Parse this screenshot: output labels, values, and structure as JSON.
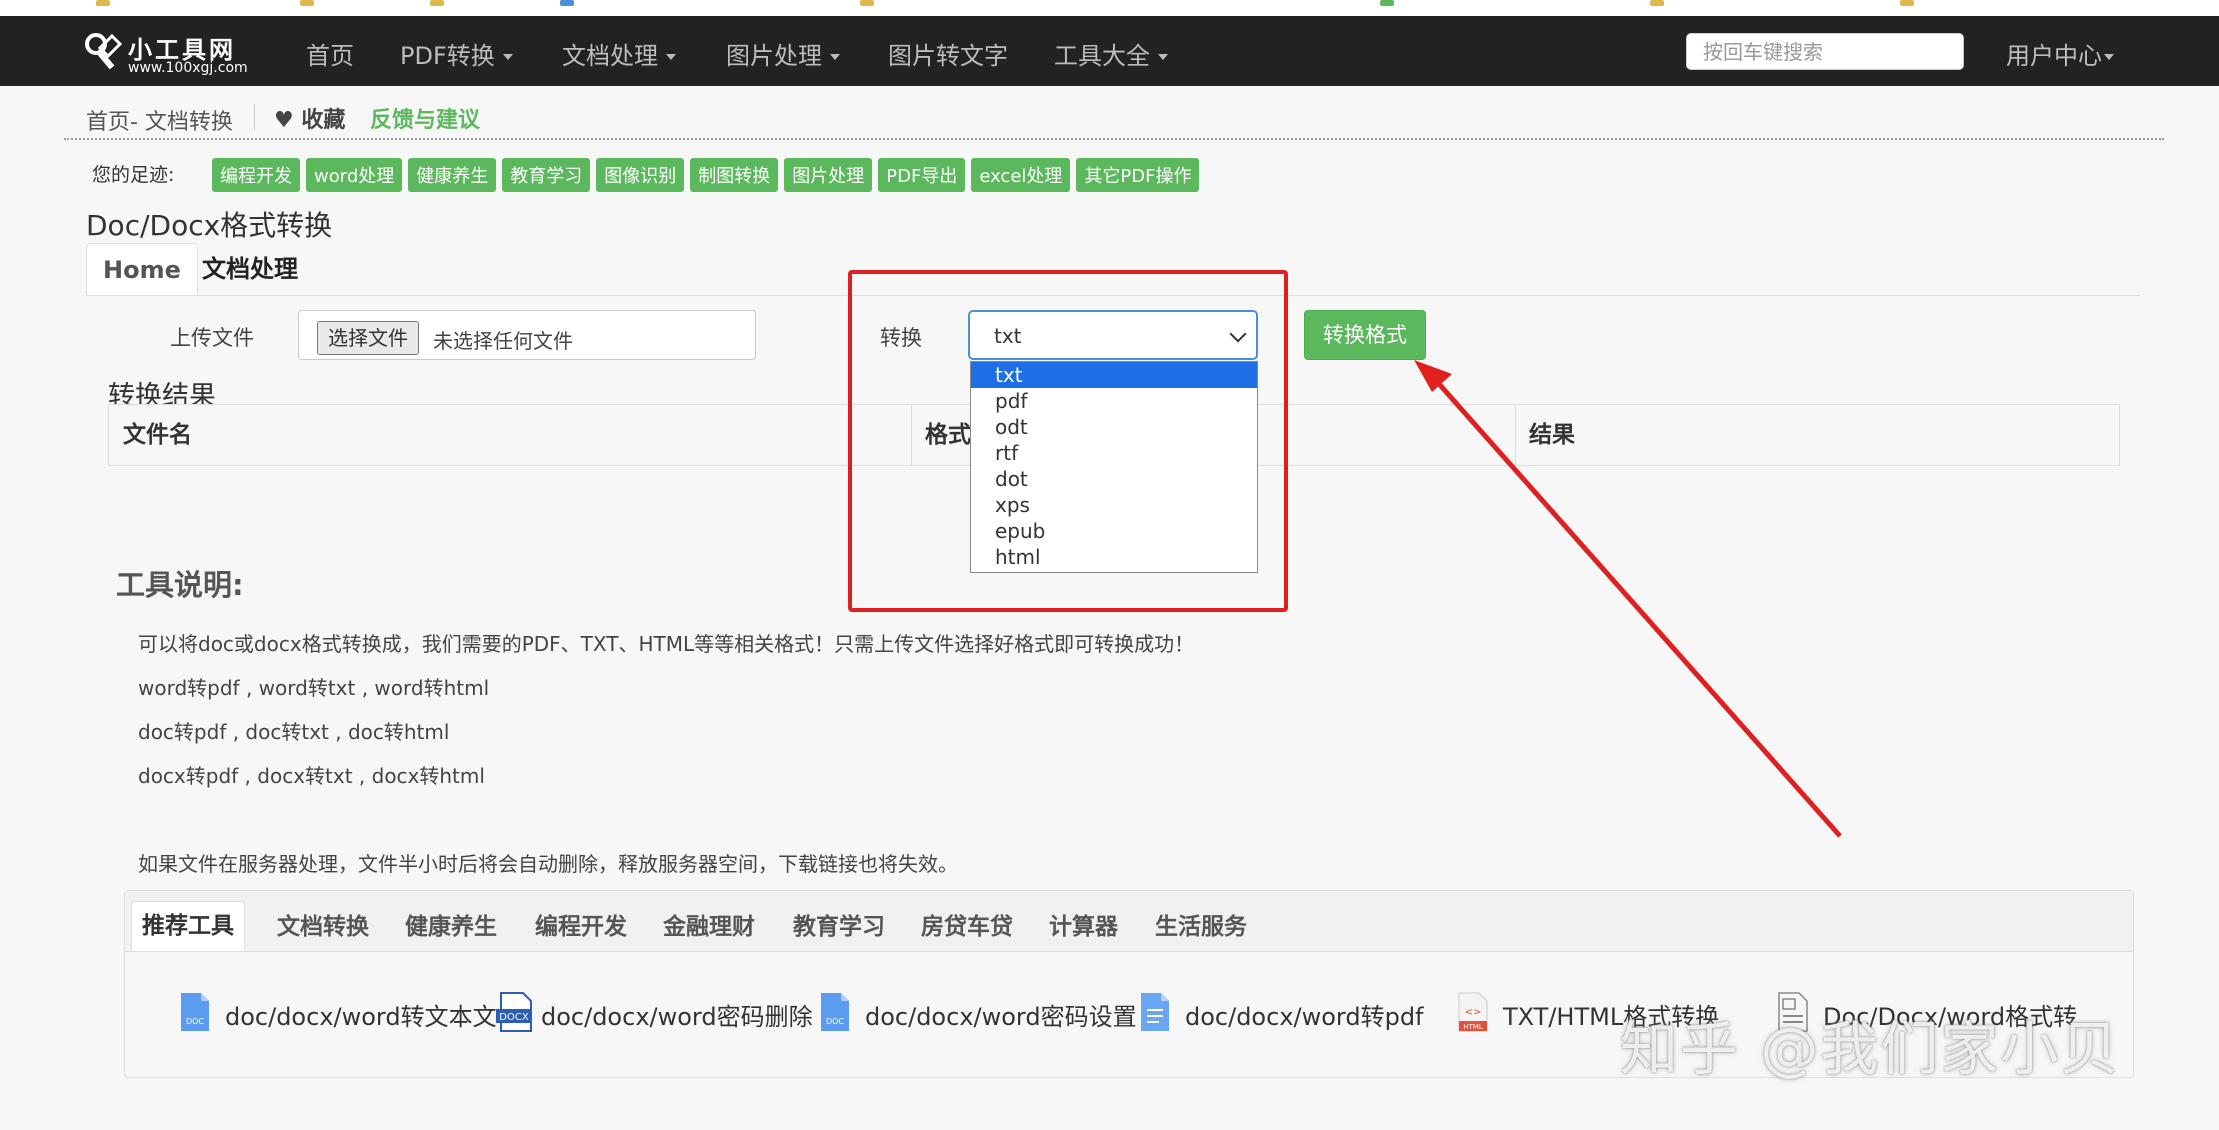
{
  "navbar": {
    "logo_name": "小工具网",
    "logo_url": "www.100xgj.com",
    "items": [
      {
        "label": "首页",
        "dropdown": false
      },
      {
        "label": "PDF转换",
        "dropdown": true
      },
      {
        "label": "文档处理",
        "dropdown": true
      },
      {
        "label": "图片处理",
        "dropdown": true
      },
      {
        "label": "图片转文字",
        "dropdown": false
      },
      {
        "label": "工具大全",
        "dropdown": true
      }
    ],
    "search_placeholder": "按回车键搜索",
    "user_center": "用户中心"
  },
  "breadcrumb": {
    "path": "首页- 文档转换",
    "favorite": "收藏",
    "feedback": "反馈与建议"
  },
  "footprints": {
    "label": "您的足迹:",
    "tags": [
      "编程开发",
      "word处理",
      "健康养生",
      "教育学习",
      "图像识别",
      "制图转换",
      "图片处理",
      "PDF导出",
      "excel处理",
      "其它PDF操作"
    ]
  },
  "page_title": "Doc/Docx格式转换",
  "tabs": [
    "Home",
    "文档处理"
  ],
  "form": {
    "upload_label": "上传文件",
    "file_button": "选择文件",
    "file_status": "未选择任何文件",
    "convert_label": "转换",
    "selected_format": "txt",
    "options": [
      "txt",
      "pdf",
      "odt",
      "rtf",
      "dot",
      "xps",
      "epub",
      "html"
    ],
    "convert_button": "转换格式"
  },
  "results": {
    "title": "转换结果",
    "columns": [
      "文件名",
      "格式",
      "结果"
    ]
  },
  "description": {
    "title": "工具说明:",
    "lines": [
      "可以将doc或docx格式转换成，我们需要的PDF、TXT、HTML等等相关格式！只需上传文件选择好格式即可转换成功！",
      "word转pdf , word转txt , word转html",
      "doc转pdf , doc转txt , doc转html",
      "docx转pdf , docx转txt , docx转html",
      "如果文件在服务器处理，文件半小时后将会自动删除，释放服务器空间，下载链接也将失效。"
    ]
  },
  "tool_panel": {
    "tabs": [
      "推荐工具",
      "文档转换",
      "健康养生",
      "编程开发",
      "金融理财",
      "教育学习",
      "房贷车贷",
      "计算器",
      "生活服务"
    ],
    "links": [
      {
        "label": "doc/docx/word转文本文",
        "icon": "doc-file-icon"
      },
      {
        "label": "doc/docx/word密码删除",
        "icon": "docx-file-icon"
      },
      {
        "label": "doc/docx/word密码设置",
        "icon": "doc-file-icon"
      },
      {
        "label": "doc/docx/word转pdf",
        "icon": "document-icon"
      },
      {
        "label": "TXT/HTML格式转换",
        "icon": "html-file-icon"
      },
      {
        "label": "Doc/Docx/word格式转",
        "icon": "word-file-icon"
      }
    ]
  },
  "watermark": "知乎 @我们家小贝",
  "colors": {
    "navbar": "#222222",
    "accent_green": "#5cb85c",
    "select_highlight": "#1e6fe6",
    "annotation_red": "#e02020"
  }
}
